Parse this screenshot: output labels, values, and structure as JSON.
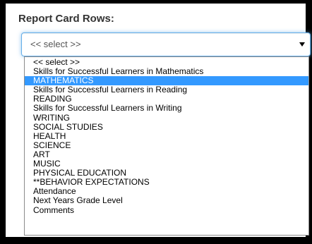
{
  "field": {
    "label": "Report Card Rows:",
    "selected_value": "<< select >>"
  },
  "dropdown": {
    "highlighted_index": 2,
    "options": [
      "<< select >>",
      "Skills for Successful Learners in Mathematics",
      "MATHEMATICS",
      "Skills for Successful Learners in Reading",
      "READING",
      "Skills for Successful Learners in Writing",
      "WRITING",
      "SOCIAL STUDIES",
      "HEALTH",
      "SCIENCE",
      "ART",
      "MUSIC",
      "PHYSICAL EDUCATION",
      "**BEHAVIOR EXPECTATIONS",
      "Attendance",
      "Next Years Grade Level",
      "Comments"
    ]
  },
  "colors": {
    "highlight": "#3399ff",
    "focus_border": "#66afe9"
  }
}
